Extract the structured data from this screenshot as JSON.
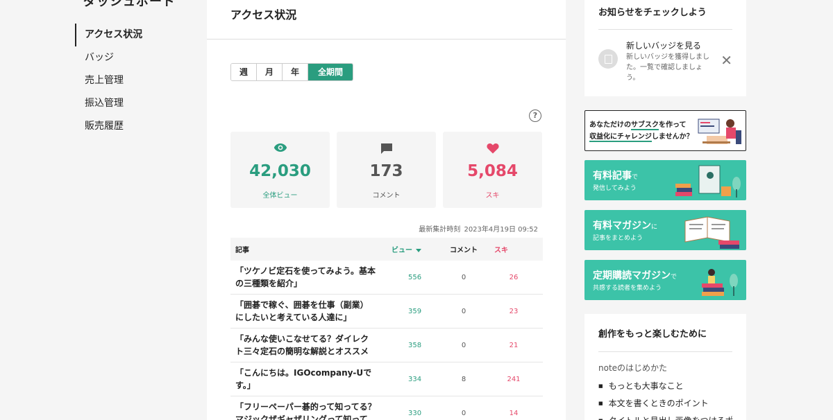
{
  "sidebar": {
    "title": "ダッシュボード",
    "items": [
      {
        "label": "アクセス状況",
        "active": true
      },
      {
        "label": "バッジ"
      },
      {
        "label": "売上管理"
      },
      {
        "label": "振込管理"
      },
      {
        "label": "販売履歴"
      }
    ]
  },
  "main": {
    "title": "アクセス状況",
    "periods": [
      "週",
      "月",
      "年",
      "全期間"
    ],
    "active_period": "全期間",
    "help_icon": "?",
    "stats": {
      "views": {
        "value": "42,030",
        "label": "全体ビュー",
        "icon": "eye-icon"
      },
      "comments": {
        "value": "173",
        "label": "コメント",
        "icon": "comment-icon"
      },
      "likes": {
        "value": "5,084",
        "label": "スキ",
        "icon": "heart-icon"
      }
    },
    "updated_label": "最新集計時刻",
    "updated_time": "2023年4月19日 09:52",
    "table": {
      "headers": {
        "title": "記事",
        "views": "ビュー",
        "comments": "コメント",
        "likes": "スキ"
      },
      "rows": [
        {
          "title": "「ツケノビ定石を使ってみよう。基本の三種類を紹介」",
          "views": "556",
          "comments": "0",
          "likes": "26"
        },
        {
          "title": "「囲碁で稼ぐ、囲碁を仕事（副業）にしたいと考えている人達に」",
          "views": "359",
          "comments": "0",
          "likes": "23"
        },
        {
          "title": "「みんな使いこなせてる？ダイレクト三々定石の簡明な解説とオススメの…",
          "views": "358",
          "comments": "0",
          "likes": "21"
        },
        {
          "title": "「こんにちは。IGOcompany-Uです。」",
          "views": "334",
          "comments": "8",
          "likes": "241"
        },
        {
          "title": "「フリーペーパー碁的って知ってる？マジックザギャザリングって知って…",
          "views": "330",
          "comments": "0",
          "likes": "14"
        }
      ]
    }
  },
  "right": {
    "notice": {
      "heading": "お知らせをチェックしよう",
      "title": "新しいバッジを見る",
      "text": "新しいバッジを獲得しました。一覧で確認しましょう。",
      "close": "✕"
    },
    "subscription_banner": {
      "line1_pre": "あなただけの",
      "line1_em": "サブスク",
      "line1_post": "を作って",
      "line2_em": "収益化にチャレンジ",
      "line2_post": "しませんか？"
    },
    "banners": [
      {
        "title": "有料記事",
        "title_suffix": "で",
        "subtitle": "発信してみよう"
      },
      {
        "title": "有料マガジン",
        "title_suffix": "に",
        "subtitle": "記事をまとめよう"
      },
      {
        "title": "定期購読マガジン",
        "title_suffix": "で",
        "subtitle": "共感する読者を集めよう"
      }
    ],
    "create": {
      "heading": "創作をもっと楽しむために",
      "subheading": "noteのはじめかた",
      "links": [
        "もっとも大事なこと",
        "本文を書くときのポイント",
        "タイトルと見出し画像をつけるポ"
      ]
    }
  },
  "colors": {
    "accent": "#2a9d7f",
    "like": "#e5486a",
    "banner": "#3cc3a8"
  }
}
